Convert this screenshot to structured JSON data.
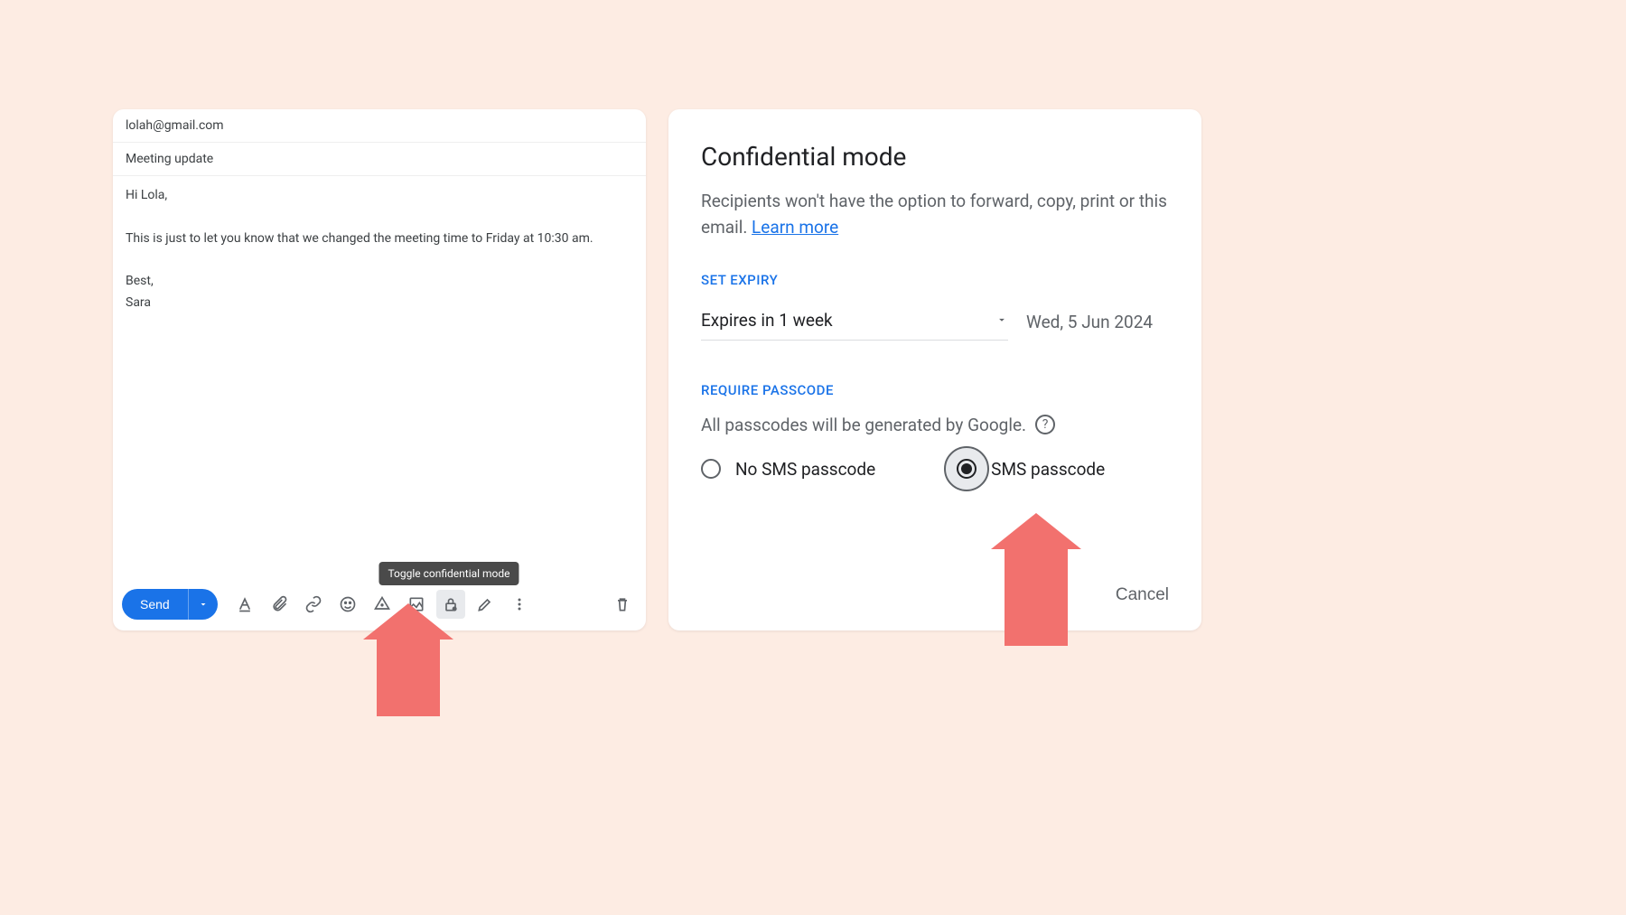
{
  "compose": {
    "to": "lolah@gmail.com",
    "subject": "Meeting update",
    "body": "Hi Lola,\n\nThis is just to let you know that we changed the meeting time to Friday at 10:30 am.\n\nBest,\nSara",
    "send_label": "Send",
    "tooltip": "Toggle confidential mode"
  },
  "dialog": {
    "title": "Confidential mode",
    "description_prefix": "Recipients won't have the option to forward, copy, print or ",
    "description_suffix": "this email. ",
    "learn_more": "Learn more",
    "set_expiry_label": "SET EXPIRY",
    "expiry_value": "Expires in 1 week",
    "expiry_date": "Wed, 5 Jun 2024",
    "require_passcode_label": "REQUIRE PASSCODE",
    "passcode_note": "All passcodes will be generated by Google.",
    "option_no_sms": "No SMS passcode",
    "option_sms": "SMS passcode",
    "cancel": "Cancel"
  }
}
